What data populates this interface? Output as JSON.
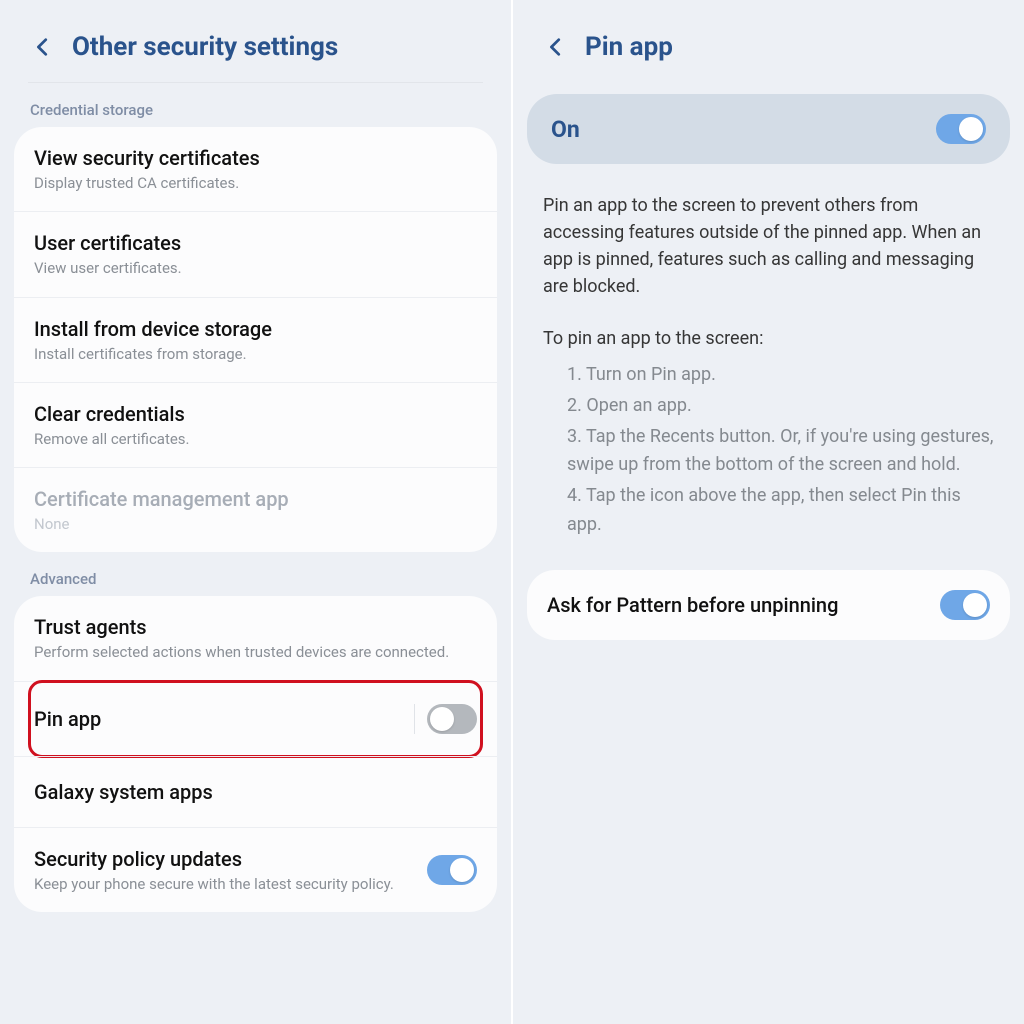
{
  "left": {
    "title": "Other security settings",
    "section1_label": "Credential storage",
    "section2_label": "Advanced",
    "items1": [
      {
        "title": "View security certificates",
        "sub": "Display trusted CA certificates."
      },
      {
        "title": "User certificates",
        "sub": "View user certificates."
      },
      {
        "title": "Install from device storage",
        "sub": "Install certificates from storage."
      },
      {
        "title": "Clear credentials",
        "sub": "Remove all certificates."
      },
      {
        "title": "Certificate management app",
        "sub": "None"
      }
    ],
    "items2": [
      {
        "title": "Trust agents",
        "sub": "Perform selected actions when trusted devices are connected."
      },
      {
        "title": "Pin app"
      },
      {
        "title": "Galaxy system apps"
      },
      {
        "title": "Security policy updates",
        "sub": "Keep your phone secure with the latest security policy."
      }
    ]
  },
  "right": {
    "title": "Pin app",
    "pill_label": "On",
    "info_paragraph": "Pin an app to the screen to prevent others from accessing features outside of the pinned app. When an app is pinned, features such as calling and messaging are blocked.",
    "info_lead": "To pin an app to the screen:",
    "steps": [
      "1. Turn on Pin app.",
      "2. Open an app.",
      "3. Tap the Recents button. Or, if you're using gestures, swipe up from the bottom of the screen and hold.",
      "4. Tap the icon above the app, then select Pin this app."
    ],
    "ask_pattern_label": "Ask for Pattern before unpinning"
  }
}
